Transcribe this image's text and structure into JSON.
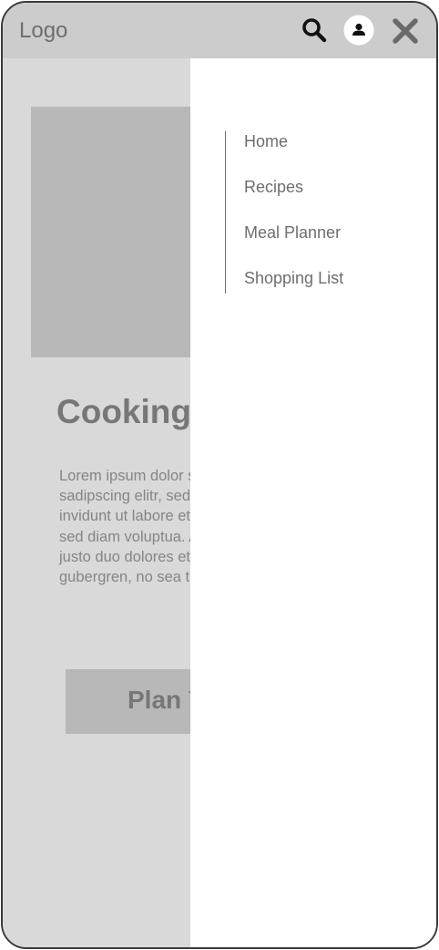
{
  "header": {
    "logo": "Logo",
    "icons": {
      "search": "search-icon",
      "profile": "user-profile-icon",
      "close": "close-icon"
    }
  },
  "main": {
    "headline": "Cooking",
    "body": "Lorem ipsum dolor sit amet, consetetur sadipscing elitr, sed diam nonumy eirmod tempor invidunt ut labore et dolore magna aliquyam erat, sed diam voluptua. At vero eos et accusam et justo duo dolores et ea rebum. Stet clita kasd gubergren, no sea takimata sanctus est.",
    "cta_label": "Plan Y"
  },
  "nav": {
    "items": [
      {
        "label": "Home"
      },
      {
        "label": "Recipes"
      },
      {
        "label": "Meal Planner"
      },
      {
        "label": "Shopping List"
      }
    ]
  },
  "colors": {
    "header_bg": "#cccccc",
    "content_bg": "#d9d9d9",
    "placeholder": "#b8b8b8",
    "drawer_bg": "#ffffff",
    "text_muted": "#6e6e6e"
  }
}
